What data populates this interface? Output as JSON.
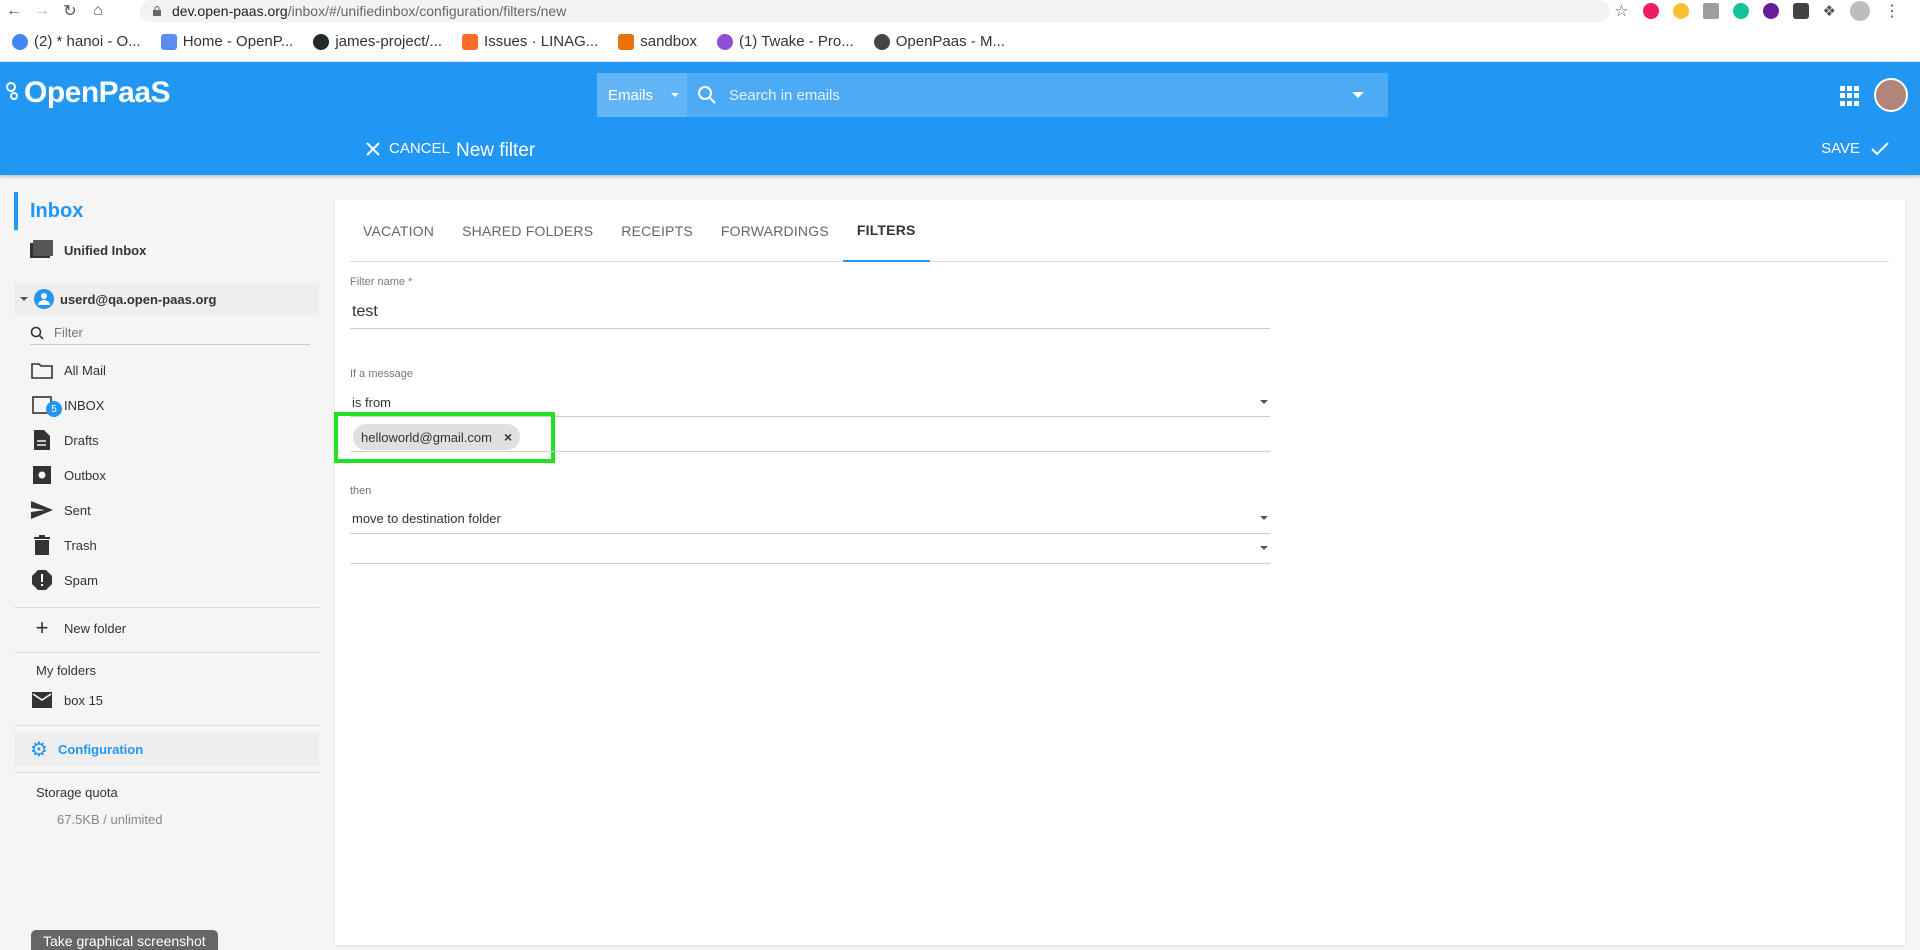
{
  "browser": {
    "url_host": "dev.open-paas.org",
    "url_path": "/inbox/#/unifiedinbox/configuration/filters/new",
    "bookmarks": [
      {
        "label": "(2) * hanoi - O...",
        "color": "#4285f4"
      },
      {
        "label": "Home - OpenP...",
        "color": "#5b8def"
      },
      {
        "label": "james-project/...",
        "color": "#24292e"
      },
      {
        "label": "Issues · LINAG...",
        "color": "#fc6d26"
      },
      {
        "label": "sandbox",
        "color": "#e8710a"
      },
      {
        "label": "(1) Twake - Pro...",
        "color": "#8e4fd6"
      },
      {
        "label": "OpenPaas - M...",
        "color": "#444444"
      }
    ]
  },
  "header": {
    "logo": "OpenPaaS",
    "search_scope": "Emails",
    "search_placeholder": "Search in emails",
    "cancel_label": "CANCEL",
    "title": "New filter",
    "save_label": "SAVE"
  },
  "sidebar": {
    "title": "Inbox",
    "unified_inbox": "Unified Inbox",
    "account": "userd@qa.open-paas.org",
    "filter_placeholder": "Filter",
    "folders": [
      {
        "label": "All Mail",
        "icon": "folder-icon"
      },
      {
        "label": "INBOX",
        "icon": "inbox-icon",
        "badge": "5"
      },
      {
        "label": "Drafts",
        "icon": "drafts-icon"
      },
      {
        "label": "Outbox",
        "icon": "outbox-icon"
      },
      {
        "label": "Sent",
        "icon": "send-icon"
      },
      {
        "label": "Trash",
        "icon": "trash-icon"
      },
      {
        "label": "Spam",
        "icon": "spam-icon"
      }
    ],
    "new_folder": "New folder",
    "my_folders_label": "My folders",
    "my_folders": [
      {
        "label": "box 15",
        "icon": "mail-icon"
      }
    ],
    "configuration": "Configuration",
    "storage_label": "Storage quota",
    "storage_value": "67.5KB / unlimited"
  },
  "tabs": [
    "VACATION",
    "SHARED FOLDERS",
    "RECEIPTS",
    "FORWARDINGS",
    "FILTERS"
  ],
  "active_tab": "FILTERS",
  "form": {
    "filter_name_label": "Filter name *",
    "filter_name_value": "test",
    "condition_label": "If a message",
    "condition_value": "is from",
    "chip_value": "helloworld@gmail.com",
    "action_label": "then",
    "action_value": "move to destination folder",
    "destination_value": ""
  },
  "tooltip": "Take graphical screenshot",
  "colors": {
    "primary": "#2196f3",
    "highlight": "#22e022"
  }
}
